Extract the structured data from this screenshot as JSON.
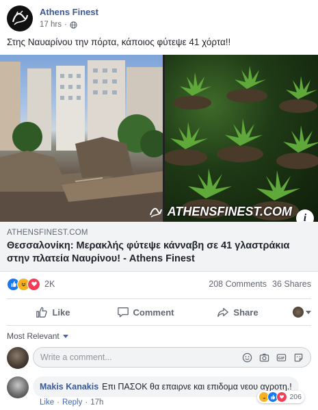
{
  "post": {
    "page_name": "Athens Finest",
    "time": "17 hrs",
    "separator": "·",
    "text": "Στης Ναυαρίνου την πόρτα, κάποιος φύτεψε 41 χόρτα!!",
    "avatar_icon": "athens-finest-logo",
    "privacy_icon": "globe-icon"
  },
  "link": {
    "watermark": "ATHENSFINEST.COM",
    "info_label": "i",
    "domain": "ATHENSFINEST.COM",
    "title": "Θεσσαλονίκη: Μερακλής φύτεψε κάνναβη σε 41 γλαστράκια στην πλατεία Ναυρίνου! - Athens Finest"
  },
  "reactions": {
    "count": "2K",
    "types": [
      "like",
      "haha",
      "love"
    ],
    "comments": "208 Comments",
    "shares": "36 Shares"
  },
  "actions": {
    "like": "Like",
    "comment": "Comment",
    "share": "Share"
  },
  "comments_section": {
    "sort_label": "Most Relevant",
    "compose_placeholder": "Write a comment...",
    "compose_tools": [
      "emoji-icon",
      "camera-icon",
      "gif-icon",
      "sticker-icon"
    ],
    "items": [
      {
        "author": "Makis Kanakis",
        "text": "Επι ΠΑΣΟΚ θα επαιρνε και επιδομα νεου αγροτη.!",
        "like_label": "Like",
        "reply_label": "Reply",
        "time": "17h",
        "reaction_count": "206",
        "reaction_types": [
          "haha",
          "like",
          "love"
        ]
      }
    ]
  },
  "colors": {
    "facebook_blue": "#4267b2",
    "link_name": "#365899",
    "like_blue": "#1877f2",
    "love_red": "#f33e58",
    "haha_yellow": "#f7b125"
  }
}
